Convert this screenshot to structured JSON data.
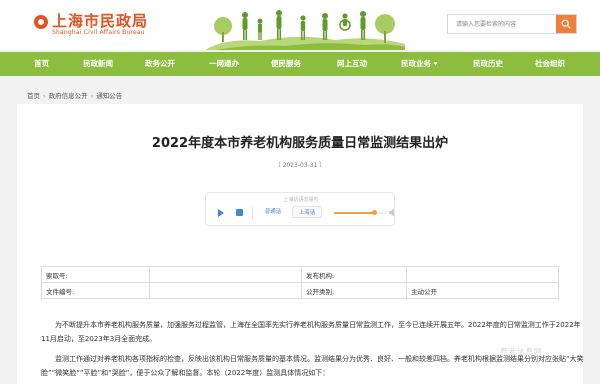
{
  "header": {
    "logo_cn": "上海市民政局",
    "logo_en": "Shanghai Civil Affairs Bureau",
    "search_placeholder": "请输入您要检索的内容",
    "accent_color": "#f07f3c",
    "brand_color": "#e8501e",
    "search_icon": "search-icon"
  },
  "nav": {
    "bg_color": "#8cbd3f",
    "items": [
      {
        "label": "首页"
      },
      {
        "label": "民政新闻"
      },
      {
        "label": "政务公开"
      },
      {
        "label": "一网通办"
      },
      {
        "label": "便民服务"
      },
      {
        "label": "网上互动"
      },
      {
        "label": "民政业务 ▾"
      },
      {
        "label": "民政历史"
      },
      {
        "label": "社会组织"
      }
    ]
  },
  "breadcrumb": {
    "items": [
      "首页",
      "政府信息公开",
      "通知公告"
    ],
    "separator": "›"
  },
  "article": {
    "title": "2022年度本市养老机构服务质量日常监测结果出炉",
    "date": "（ 2023-03-31 ）"
  },
  "player": {
    "hint": "上海话语音服务",
    "dialect_options": [
      "普通话",
      "上海话"
    ],
    "selected_dialect": "上海话",
    "progress_fraction": 0.78
  },
  "info_table": {
    "rows": [
      {
        "label1": "索取号:",
        "value1": "",
        "label2": "发布机构:",
        "value2": ""
      },
      {
        "label1": "文件编号:",
        "value1": "",
        "label2": "公开类别:",
        "value2": "主动公开"
      }
    ]
  },
  "body": {
    "paragraph1": "为不断提升本市养老机构服务质量，加强服务过程监管，上海在全国率先实行养老机构服务质量日常监测工作，至今已连续开展五年。2022年度的日常监测工作于2022年11月启动，至2023年3月全面完成。",
    "paragraph2": "监测工作通过对养老机构各项指标的检查，反映出该机构日常服务质量的基本情况。监测结果分为优秀、良好、一般和较差四档。养老机构根据监测结果分别对应张贴“大笑脸”“微笑脸”“平脸”和“哭脸”，便于公众了解和监督。本轮（2022年度）监测具体情况如下："
  },
  "watermark": "养老信息网"
}
